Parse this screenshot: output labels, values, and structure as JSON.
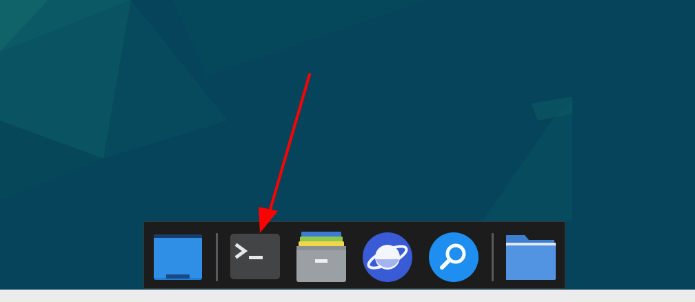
{
  "desktop": {
    "wallpaper": "teal-abstract",
    "colors": {
      "base": "#05445a",
      "light": "#0d5f6a"
    }
  },
  "dock": {
    "background": "#1c1c1d",
    "items": [
      {
        "name": "show-desktop",
        "icon": "window-icon",
        "color": "#2f8fe6"
      },
      {
        "name": "terminal",
        "icon": "terminal-icon",
        "color": "#434446"
      },
      {
        "name": "archive-manager",
        "icon": "archive-icon",
        "color": "#9aa0a4"
      },
      {
        "name": "web-browser",
        "icon": "planet-browser-icon",
        "color": "#3a5bd6"
      },
      {
        "name": "search",
        "icon": "magnifier-icon",
        "color": "#1e8ff0"
      },
      {
        "name": "file-manager",
        "icon": "folder-icon",
        "color": "#5294e2"
      }
    ]
  },
  "annotation": {
    "type": "arrow",
    "color": "#ff0000",
    "points_to": "terminal"
  }
}
